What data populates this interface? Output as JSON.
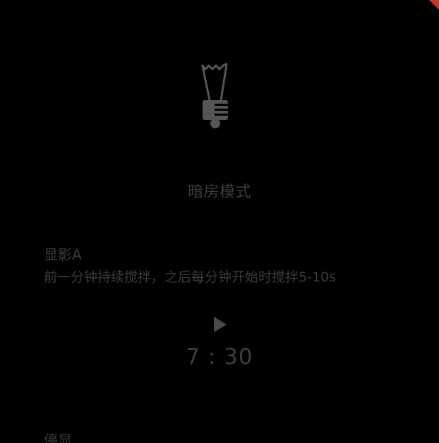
{
  "mode_title": "暗房模式",
  "step": {
    "title": "显影A",
    "description": "前一分钟持续搅拌，之后每分钟开始时搅拌5-10s"
  },
  "timer": {
    "display": "7 : 30"
  },
  "next_section": {
    "title": "停显"
  },
  "colors": {
    "background": "#000000",
    "text": "#3a3a3a",
    "icon": "#555555",
    "accent": "#b83a32"
  },
  "icons": {
    "bulb": "lightbulb-icon",
    "play": "play-icon"
  }
}
